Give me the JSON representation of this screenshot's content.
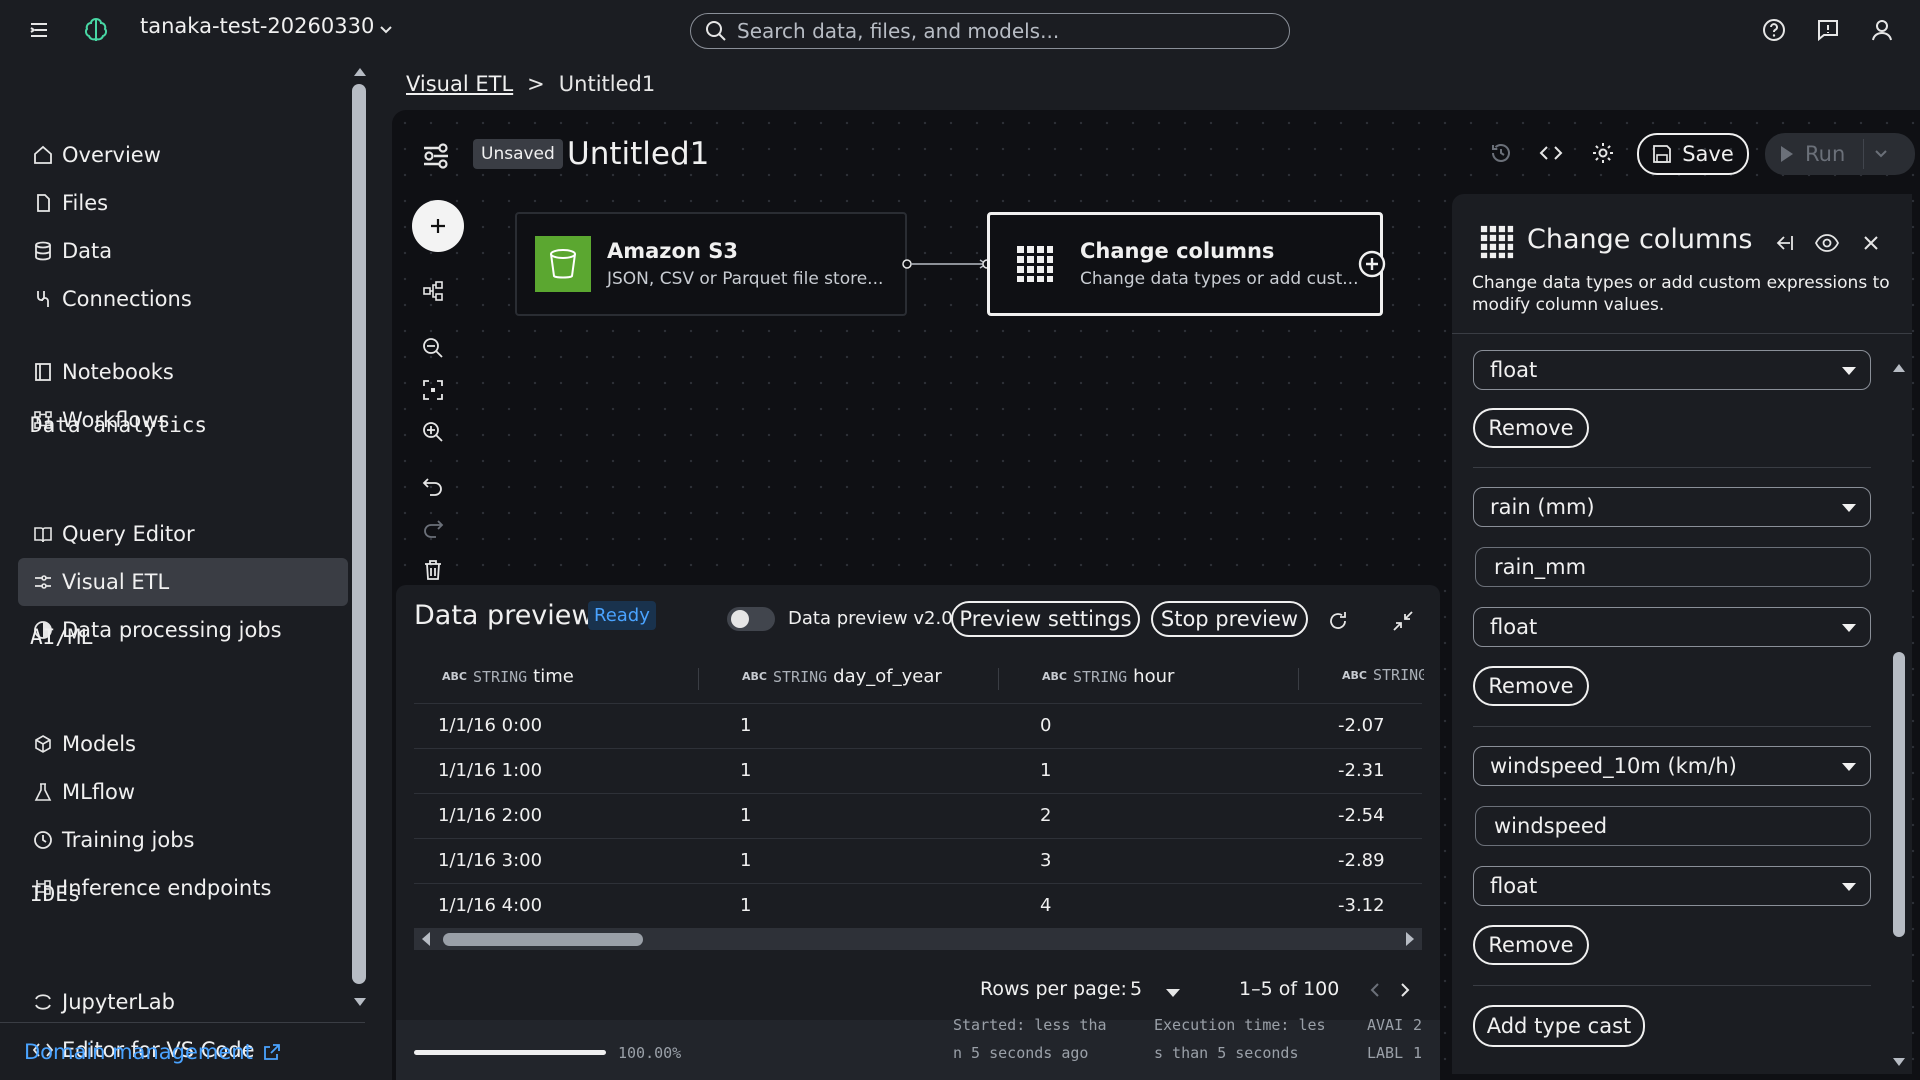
{
  "topbar": {
    "project_name": "tanaka-test-20260330",
    "search_placeholder": "Search data, files, and models..."
  },
  "sidebar": {
    "items_top": [
      {
        "label": "Overview",
        "icon": "home-icon"
      },
      {
        "label": "Files",
        "icon": "file-icon"
      },
      {
        "label": "Data",
        "icon": "database-icon"
      },
      {
        "label": "Connections",
        "icon": "connections-icon"
      }
    ],
    "items_mid": [
      {
        "label": "Notebooks",
        "icon": "notebook-icon"
      },
      {
        "label": "Workflows",
        "icon": "workflow-icon"
      }
    ],
    "section_analytics": "Data analytics",
    "items_analytics": [
      {
        "label": "Query Editor",
        "icon": "book-icon"
      },
      {
        "label": "Visual ETL",
        "icon": "visual-etl-icon"
      },
      {
        "label": "Data processing jobs",
        "icon": "processing-icon"
      }
    ],
    "section_aiml": "AI/ML",
    "items_aiml": [
      {
        "label": "Models",
        "icon": "cube-icon"
      },
      {
        "label": "MLflow",
        "icon": "flask-icon"
      },
      {
        "label": "Training jobs",
        "icon": "clock-icon"
      },
      {
        "label": "Inference endpoints",
        "icon": "endpoint-icon"
      }
    ],
    "section_ides": "IDEs",
    "items_ides": [
      {
        "label": "JupyterLab",
        "icon": "jupyter-icon"
      },
      {
        "label": "Editor for VS Code",
        "icon": "code-icon"
      }
    ],
    "domain_management": "Domain management"
  },
  "breadcrumb": {
    "parent": "Visual ETL",
    "separator": ">",
    "current": "Untitled1"
  },
  "flow": {
    "status_badge": "Unsaved",
    "title": "Untitled1",
    "save_label": "Save",
    "run_label": "Run",
    "nodes": [
      {
        "title": "Amazon S3",
        "subtitle": "JSON, CSV or Parquet file store..."
      },
      {
        "title": "Change columns",
        "subtitle": "Change data types or add cust..."
      }
    ]
  },
  "preview": {
    "title": "Data preview",
    "status": "Ready",
    "toggle_label": "Data preview v2.0",
    "settings_button": "Preview settings",
    "stop_button": "Stop preview",
    "type_tag": "ABC",
    "columns": [
      {
        "type": "STRING",
        "name": "time"
      },
      {
        "type": "STRING",
        "name": "day_of_year"
      },
      {
        "type": "STRING",
        "name": "hour"
      },
      {
        "type": "STRING",
        "name": ""
      }
    ],
    "rows": [
      [
        "1/1/16 0:00",
        "1",
        "0",
        "-2.07"
      ],
      [
        "1/1/16 1:00",
        "1",
        "1",
        "-2.31"
      ],
      [
        "1/1/16 2:00",
        "1",
        "2",
        "-2.54"
      ],
      [
        "1/1/16 3:00",
        "1",
        "3",
        "-2.89"
      ],
      [
        "1/1/16 4:00",
        "1",
        "4",
        "-3.12"
      ]
    ],
    "rows_per_page_label": "Rows per page:",
    "rows_per_page_value": "5",
    "range": "1–5 of 100",
    "started_line1": "Started: less tha",
    "started_line2": "n 5 seconds ago",
    "exec_line1": "Execution time: les",
    "exec_line2": "s than 5 seconds",
    "avai_label": "AVAI",
    "avai_value": "2",
    "labl_label": "LABL",
    "labl_value": "1",
    "progress_pct": "100.00%"
  },
  "panel": {
    "title": "Change columns",
    "description": "Change data types or add custom expressions to modify column values.",
    "groups": [
      {
        "type": "float",
        "remove": "Remove"
      },
      {
        "column": "rain (mm)",
        "name": "rain_mm",
        "type": "float",
        "remove": "Remove"
      },
      {
        "column": "windspeed_10m (km/h)",
        "name": "windspeed",
        "type": "float",
        "remove": "Remove"
      }
    ],
    "add_button": "Add type cast"
  }
}
